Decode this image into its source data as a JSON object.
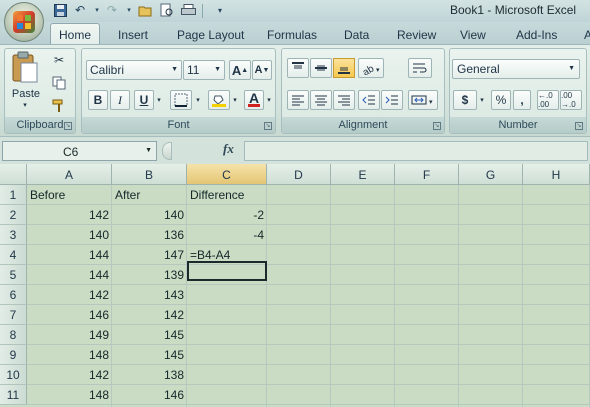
{
  "title": "Book1 - Microsoft Excel",
  "quick_access": {
    "icons": [
      "save-icon",
      "undo-icon",
      "redo-icon",
      "open-icon",
      "print-preview-icon",
      "print-icon"
    ]
  },
  "tabs": [
    "Home",
    "Insert",
    "Page Layout",
    "Formulas",
    "Data",
    "Review",
    "View",
    "Add-Ins",
    "A"
  ],
  "active_tab": "Home",
  "ribbon": {
    "clipboard": {
      "label": "Clipboard",
      "paste": "Paste"
    },
    "font": {
      "label": "Font",
      "name": "Calibri",
      "size": "11",
      "grow": "A",
      "shrink": "A",
      "bold": "B",
      "italic": "I",
      "underline": "U",
      "font_color_letter": "A",
      "fill_color": "#f5d000",
      "font_color": "#d02020"
    },
    "alignment": {
      "label": "Alignment",
      "active": "align-bottom"
    },
    "number": {
      "label": "Number",
      "format": "General",
      "currency": "$",
      "percent": "%",
      "comma": ",",
      "inc_decimal": "←.0 .00",
      "dec_decimal": ".00 →.0"
    }
  },
  "formula_bar": {
    "name_box": "C6",
    "fx": "fx",
    "content": ""
  },
  "columns": [
    "A",
    "B",
    "C",
    "D",
    "E",
    "F",
    "G",
    "H"
  ],
  "active_column": "C",
  "rows": [
    {
      "n": "1",
      "cells": [
        "Before",
        "After",
        "Difference"
      ]
    },
    {
      "n": "2",
      "cells": [
        "142",
        "140",
        "-2"
      ]
    },
    {
      "n": "3",
      "cells": [
        "140",
        "136",
        "-4"
      ]
    },
    {
      "n": "4",
      "cells": [
        "144",
        "147",
        "=B4-A4"
      ]
    },
    {
      "n": "5",
      "cells": [
        "144",
        "139",
        ""
      ]
    },
    {
      "n": "6",
      "cells": [
        "142",
        "143",
        ""
      ]
    },
    {
      "n": "7",
      "cells": [
        "146",
        "142",
        ""
      ]
    },
    {
      "n": "8",
      "cells": [
        "149",
        "145",
        ""
      ]
    },
    {
      "n": "9",
      "cells": [
        "148",
        "145",
        ""
      ]
    },
    {
      "n": "10",
      "cells": [
        "142",
        "138",
        ""
      ]
    },
    {
      "n": "11",
      "cells": [
        "148",
        "146",
        ""
      ]
    }
  ]
}
